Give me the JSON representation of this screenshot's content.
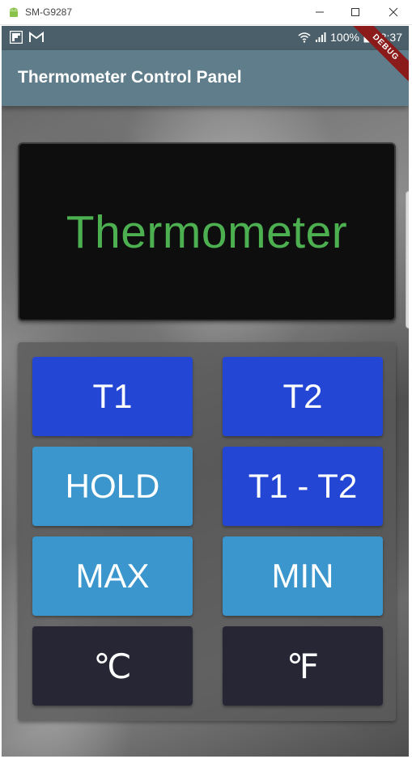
{
  "window": {
    "title": "SM-G9287",
    "icons": {
      "app": "android-icon",
      "minimize": "minimize-icon",
      "maximize": "maximize-icon",
      "close": "close-icon"
    }
  },
  "status_bar": {
    "left_icons": [
      "flipboard-icon",
      "gmail-icon"
    ],
    "right_icons": [
      "wifi-icon",
      "signal-icon",
      "battery-icon"
    ],
    "battery": "100%",
    "time": "13:37"
  },
  "app_bar": {
    "title": "Thermometer Control Panel",
    "debug_label": "DEBUG"
  },
  "display": {
    "text": "Thermometer",
    "text_color": "#4caf50"
  },
  "keypad": {
    "keys": [
      {
        "label": "T1",
        "color": "#2446d4"
      },
      {
        "label": "T2",
        "color": "#2446d4"
      },
      {
        "label": "HOLD",
        "color": "#3a96cc"
      },
      {
        "label": "T1 - T2",
        "color": "#2446d4"
      },
      {
        "label": "MAX",
        "color": "#3a96cc"
      },
      {
        "label": "MIN",
        "color": "#3a96cc"
      },
      {
        "label": "℃",
        "color": "#262634"
      },
      {
        "label": "℉",
        "color": "#262634"
      }
    ]
  },
  "colors": {
    "status_bar": "#4a5f6a",
    "app_bar": "#5f7d8b",
    "debug_banner": "#8b1a1a"
  }
}
